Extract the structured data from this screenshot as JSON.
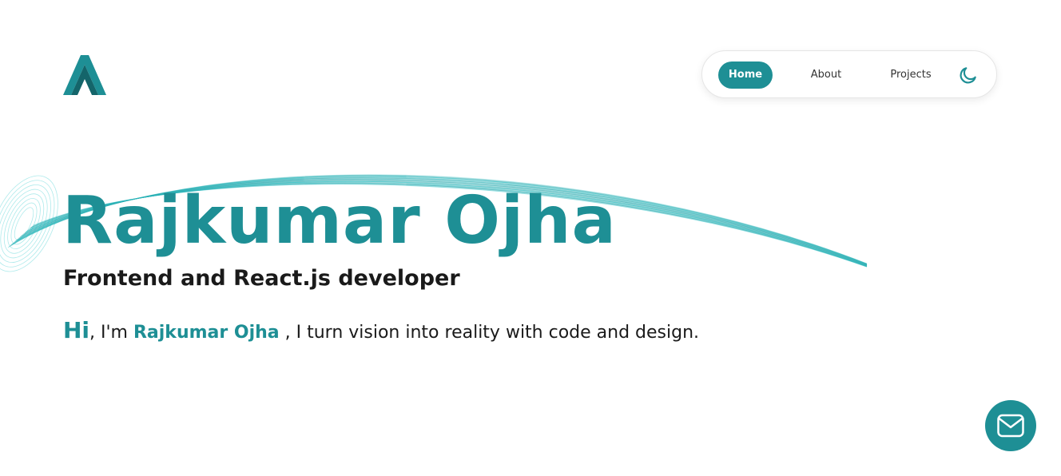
{
  "colors": {
    "accent": "#1e8f95",
    "text": "#1a1a1a"
  },
  "header": {
    "logo_icon": "letter-a-logo-icon",
    "nav": {
      "home_label": "Home",
      "about_label": "About",
      "projects_label": "Projects",
      "theme_toggle_icon": "moon-icon"
    }
  },
  "hero": {
    "name": "Rajkumar Ojha",
    "role": "Frontend and React.js developer",
    "intro": {
      "greeting": "Hi",
      "prefix": ", I'm ",
      "name": "Rajkumar Ojha",
      "suffix": " , I turn vision into reality with code and design."
    },
    "decoration_icon": "swoosh-lines-graphic"
  },
  "contact": {
    "icon": "mail-icon"
  }
}
